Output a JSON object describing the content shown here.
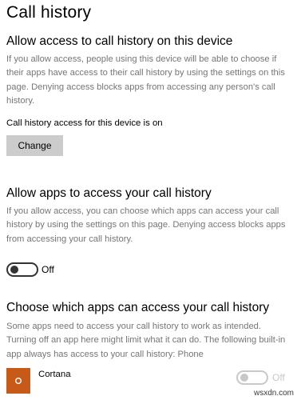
{
  "page": {
    "title": "Call history"
  },
  "device_access": {
    "heading": "Allow access to call history on this device",
    "description": "If you allow access, people using this device will be able to choose if their apps have access to their call history by using the settings on this page. Denying access blocks apps from accessing any person's call history.",
    "status": "Call history access for this device is on",
    "change_label": "Change"
  },
  "apps_access": {
    "heading": "Allow apps to access your call history",
    "description": "If you allow access, you can choose which apps can access your call history by using the settings on this page. Denying access blocks apps from accessing your call history.",
    "toggle_state": "Off"
  },
  "choose_apps": {
    "heading": "Choose which apps can access your call history",
    "description": "Some apps need to access your call history to work as intended. Turning off an app here might limit what it can do. The following built-in app always has access to your call history: Phone",
    "apps": [
      {
        "name": "Cortana",
        "toggle_state": "Off",
        "icon": "cortana-icon",
        "icon_color": "#c75a19"
      }
    ]
  },
  "watermark": "wsxdn.com"
}
